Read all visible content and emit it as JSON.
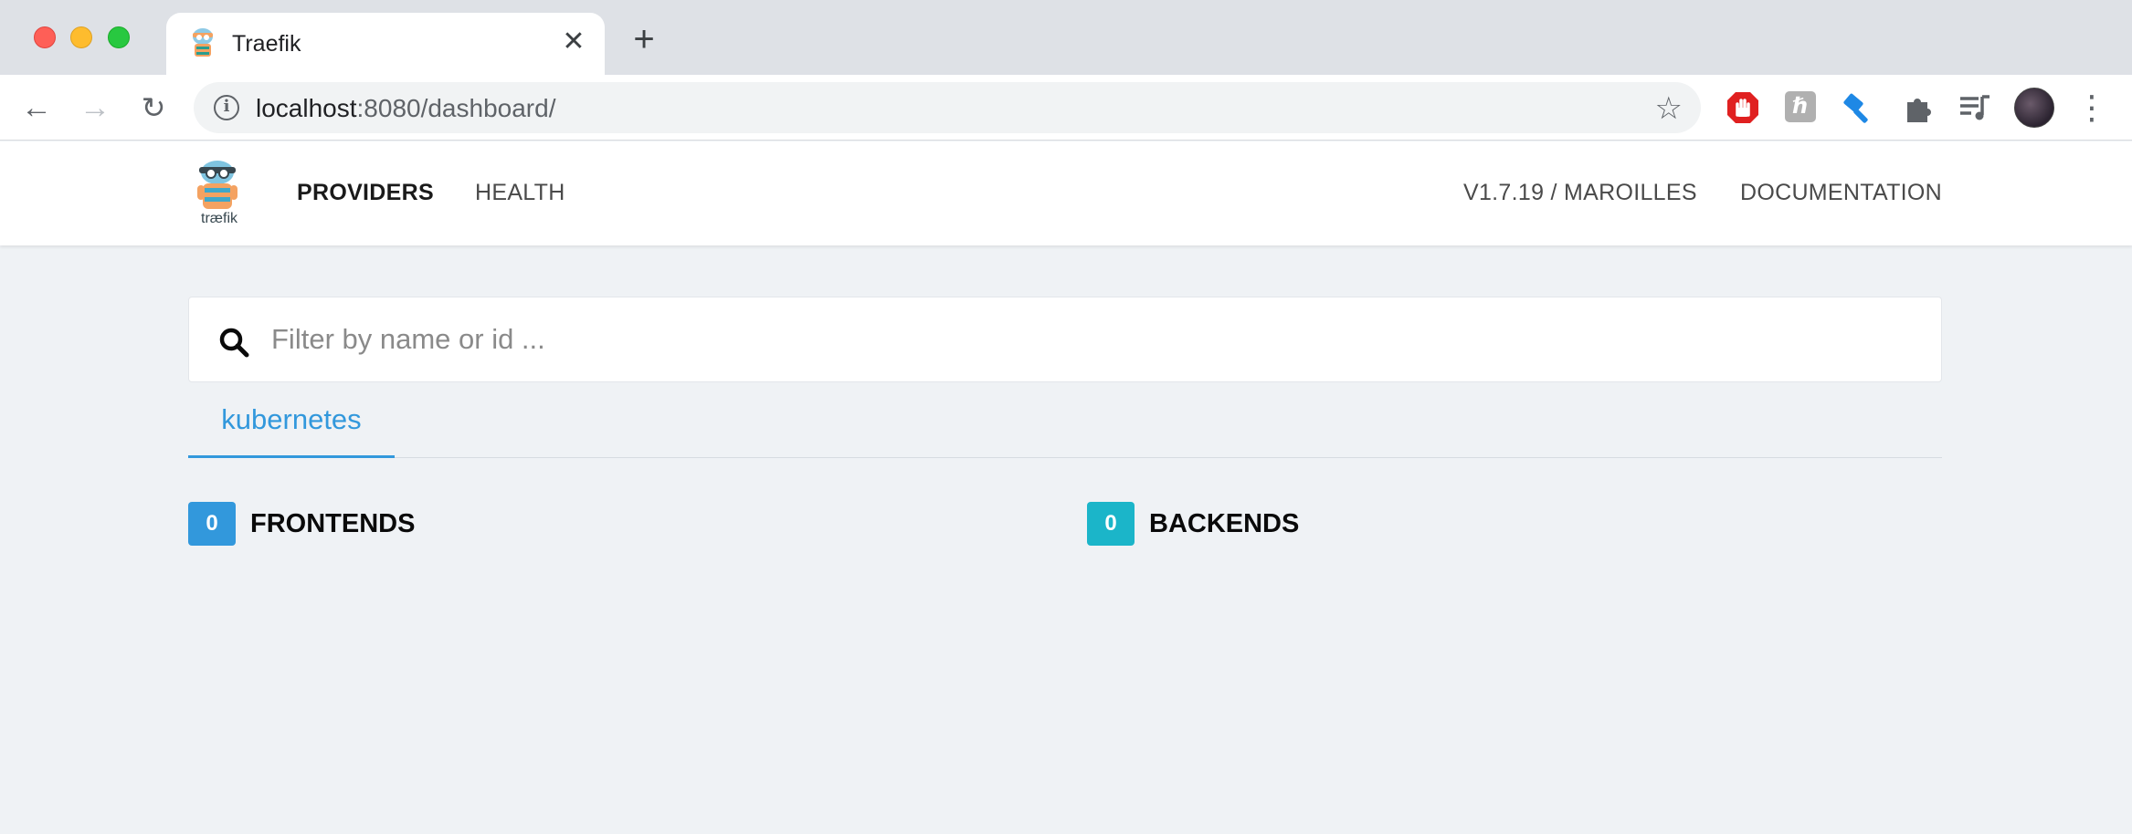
{
  "browser": {
    "tab": {
      "title": "Traefik"
    },
    "address_bar": {
      "host": "localhost",
      "path": ":8080/dashboard/"
    }
  },
  "app": {
    "logo_text": "træfik",
    "nav": {
      "providers": "PROVIDERS",
      "health": "HEALTH",
      "version": "V1.7.19 / MAROILLES",
      "documentation": "DOCUMENTATION"
    },
    "search": {
      "placeholder": "Filter by name or id ...",
      "value": ""
    },
    "provider_tabs": [
      "kubernetes"
    ],
    "frontends": {
      "count": "0",
      "label": "FRONTENDS"
    },
    "backends": {
      "count": "0",
      "label": "BACKENDS"
    }
  },
  "colors": {
    "accent": "#3298dc",
    "backends_badge": "#1bb5c9",
    "page_bg": "#eff2f5"
  }
}
